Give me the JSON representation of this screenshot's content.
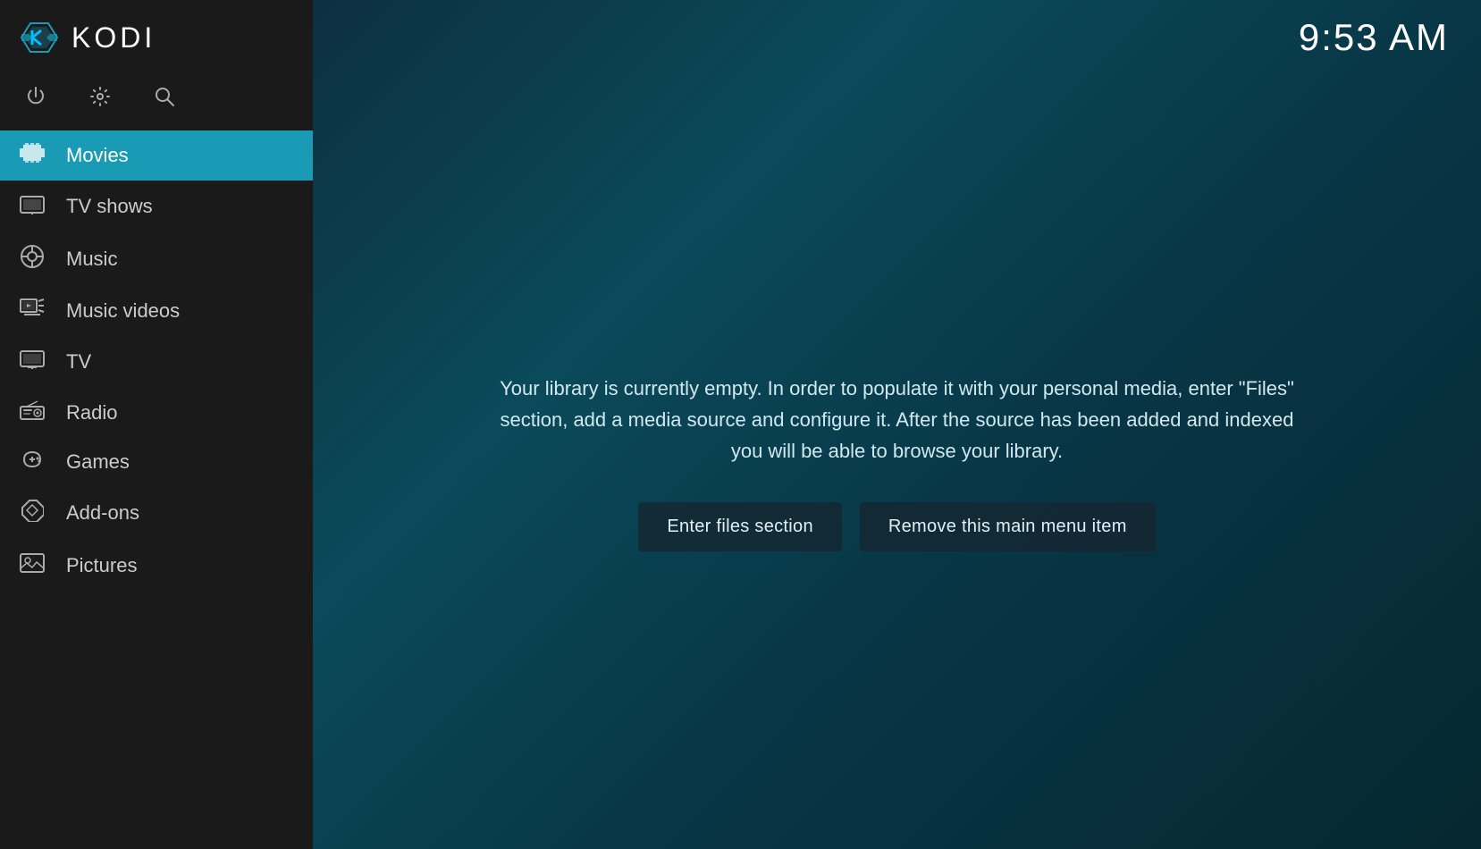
{
  "app": {
    "title": "KODI",
    "time": "9:53 AM"
  },
  "sidebar": {
    "controls": [
      {
        "name": "power-icon",
        "symbol": "⏻",
        "label": "Power"
      },
      {
        "name": "settings-icon",
        "symbol": "⚙",
        "label": "Settings"
      },
      {
        "name": "search-icon",
        "symbol": "🔍",
        "label": "Search"
      }
    ],
    "nav_items": [
      {
        "id": "movies",
        "label": "Movies",
        "icon": "🎬",
        "active": true
      },
      {
        "id": "tvshows",
        "label": "TV shows",
        "icon": "🖥",
        "active": false
      },
      {
        "id": "music",
        "label": "Music",
        "icon": "🎧",
        "active": false
      },
      {
        "id": "musicvideos",
        "label": "Music videos",
        "icon": "🎞",
        "active": false
      },
      {
        "id": "tv",
        "label": "TV",
        "icon": "📺",
        "active": false
      },
      {
        "id": "radio",
        "label": "Radio",
        "icon": "📻",
        "active": false
      },
      {
        "id": "games",
        "label": "Games",
        "icon": "🎮",
        "active": false
      },
      {
        "id": "addons",
        "label": "Add-ons",
        "icon": "📦",
        "active": false
      },
      {
        "id": "pictures",
        "label": "Pictures",
        "icon": "🖼",
        "active": false
      }
    ]
  },
  "main": {
    "empty_library_message": "Your library is currently empty. In order to populate it with your personal media, enter \"Files\" section, add a media source and configure it. After the source has been added and indexed you will be able to browse your library.",
    "btn_enter_files": "Enter files section",
    "btn_remove_item": "Remove this main menu item"
  },
  "colors": {
    "active_bg": "#1a9bb5",
    "sidebar_bg": "#1a1a1a",
    "main_bg_start": "#0d3040",
    "button_bg": "rgba(20,40,50,0.85)"
  }
}
